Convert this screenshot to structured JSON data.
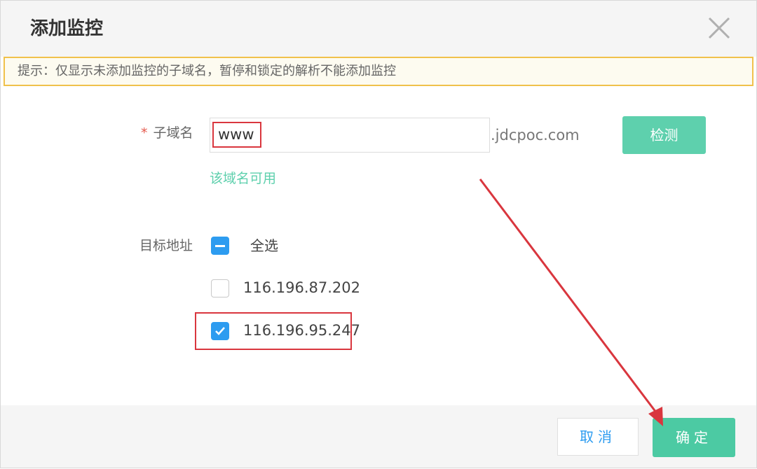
{
  "dialog": {
    "title": "添加监控",
    "close_icon": "close-icon"
  },
  "tip": {
    "text": "提示：仅显示未添加监控的子域名，暂停和锁定的解析不能添加监控"
  },
  "subdomain": {
    "required_mark": "*",
    "label": "子域名",
    "value": "www",
    "suffix": ".jdcpoc.com",
    "check_button": "检测",
    "status": "该域名可用"
  },
  "target": {
    "label": "目标地址",
    "select_all": {
      "label": "全选",
      "state": "indeterminate"
    },
    "addresses": [
      {
        "ip": "116.196.87.202",
        "checked": false
      },
      {
        "ip": "116.196.95.247",
        "checked": true
      }
    ]
  },
  "footer": {
    "cancel": "取消",
    "confirm": "确定"
  },
  "colors": {
    "accent_green": "#4ccaa3",
    "checkbox_blue": "#2d9cf0",
    "annotation_red": "#d9363e",
    "tip_border": "#f0c14b"
  }
}
